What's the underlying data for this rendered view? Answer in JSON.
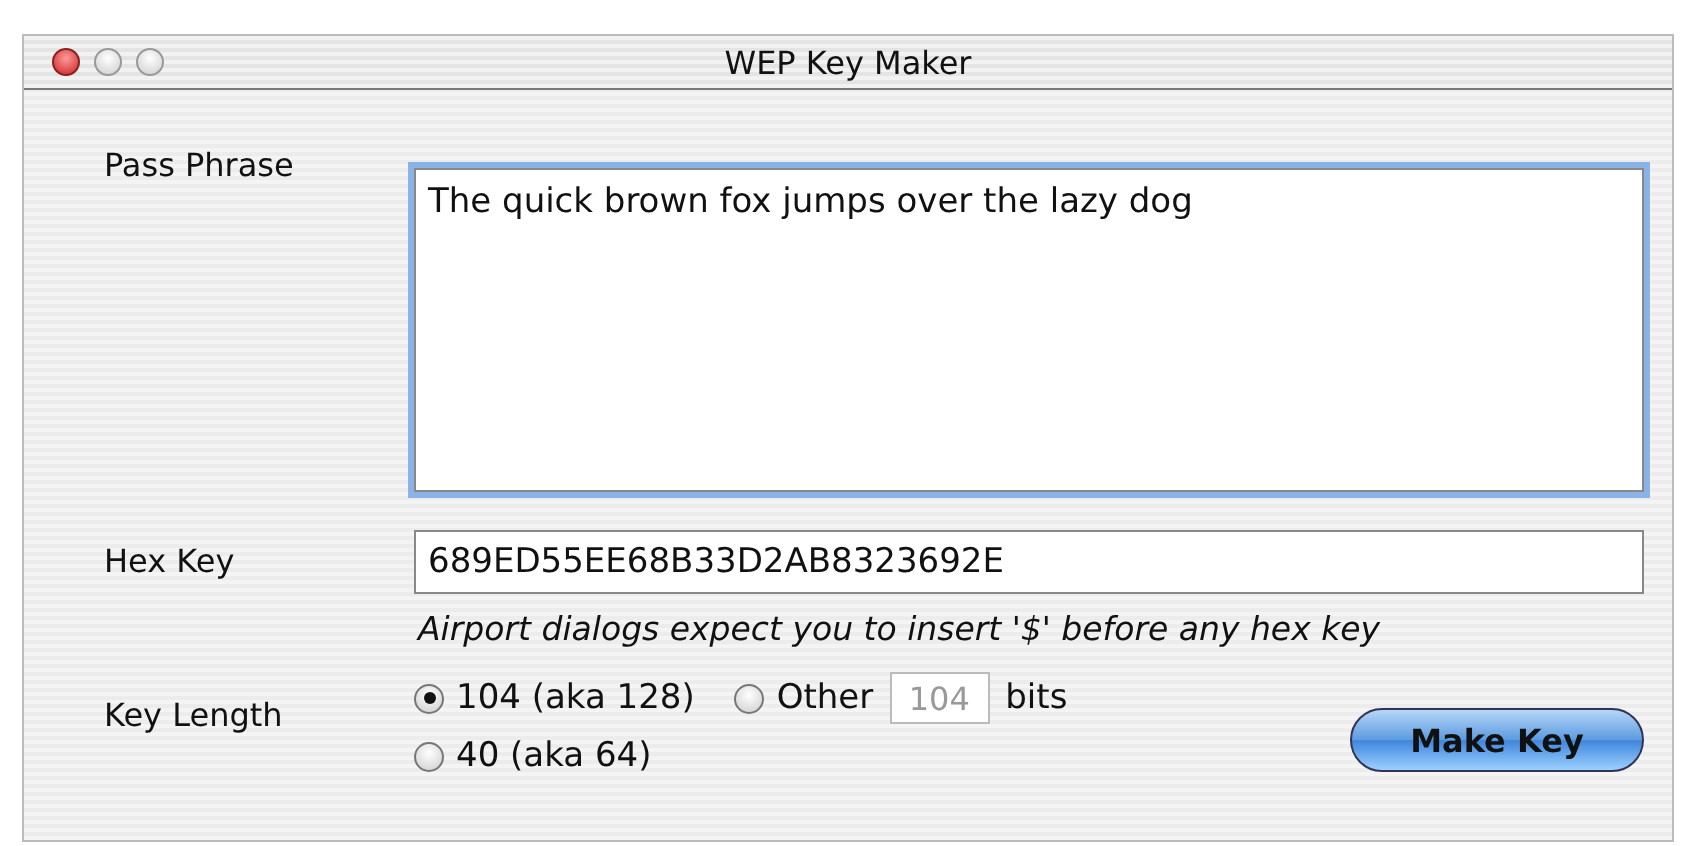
{
  "window": {
    "title": "WEP Key Maker"
  },
  "pass_phrase": {
    "label": "Pass Phrase",
    "value": "The quick brown fox jumps over the lazy dog",
    "focused": true
  },
  "hex_key": {
    "label": "Hex Key",
    "value": "689ED55EE68B33D2AB8323692E"
  },
  "note": "Airport dialogs expect you to insert '$' before any hex key",
  "key_length": {
    "label": "Key Length",
    "options": [
      {
        "label": "104 (aka 128)",
        "selected": true,
        "kind": "plain"
      },
      {
        "label": "Other",
        "selected": false,
        "kind": "custom",
        "value": "104",
        "disabled": true,
        "unit": "bits"
      },
      {
        "label": "40 (aka 64)",
        "selected": false,
        "kind": "plain"
      }
    ]
  },
  "buttons": [
    {
      "label": "Make Key",
      "default": true
    }
  ]
}
